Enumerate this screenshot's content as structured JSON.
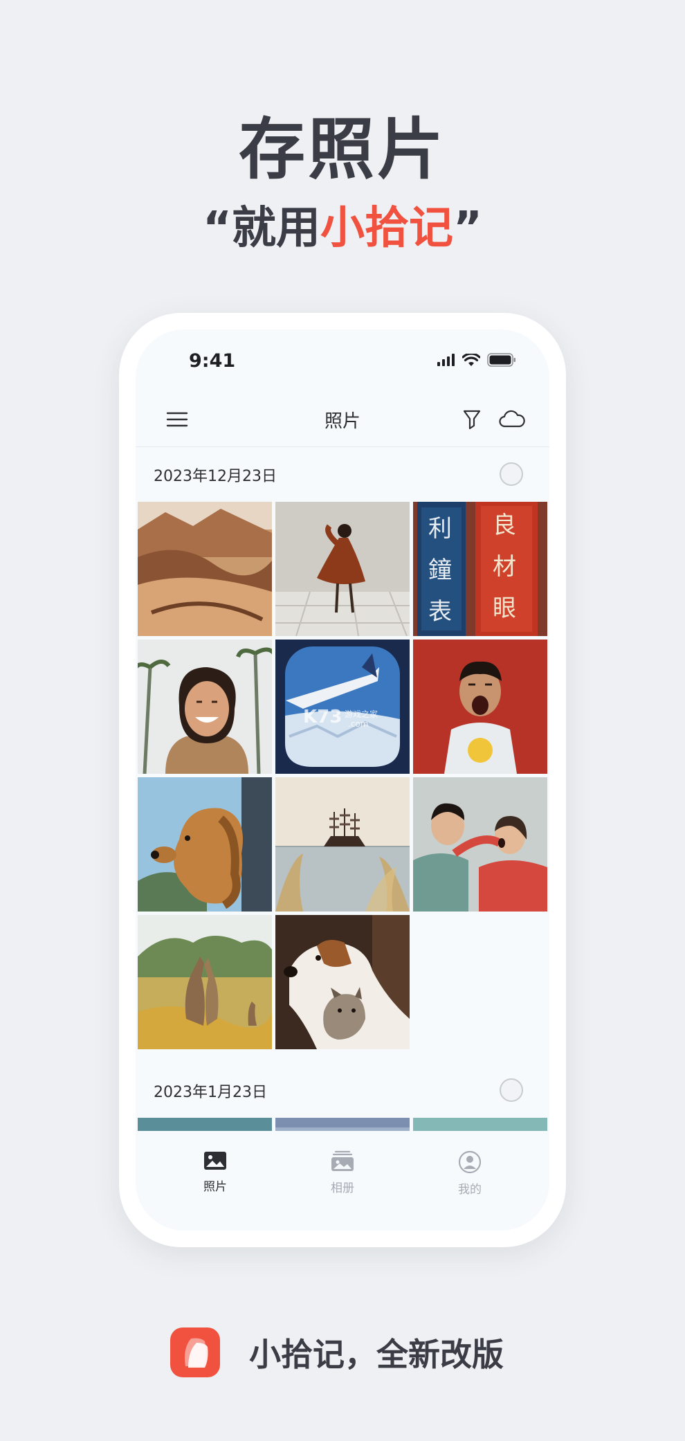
{
  "promo": {
    "headline": "存照片",
    "quote_open": "“",
    "sub_prefix": "就用",
    "sub_accent": "小拾记",
    "quote_close": "”",
    "footer": "小拾记，全新改版",
    "accent_color": "#f0523f"
  },
  "status_bar": {
    "time": "9:41"
  },
  "navbar": {
    "title": "照片",
    "left_icon": "menu-icon",
    "right_icons": [
      "filter-icon",
      "cloud-icon"
    ]
  },
  "sections": [
    {
      "date": "2023年12月23日",
      "photos": [
        "desert-dunes",
        "dancer-red-dress",
        "chinese-signboards",
        "smiling-woman-palms",
        "airplane-window-wing",
        "boy-yawning-red",
        "dog-car-window",
        "sailing-ship",
        "kids-playing",
        "kangaroos",
        "dog-and-cat"
      ]
    },
    {
      "date": "2023年1月23日",
      "photos": [
        "teal-photo",
        "sky-photo",
        "aqua-photo"
      ]
    }
  ],
  "watermark": {
    "brand": "K73",
    "cn": "游戏之家",
    "domain": ".com"
  },
  "tabbar": {
    "items": [
      {
        "label": "照片",
        "icon": "photo-icon",
        "active": true
      },
      {
        "label": "相册",
        "icon": "album-icon",
        "active": false
      },
      {
        "label": "我的",
        "icon": "profile-icon",
        "active": false
      }
    ]
  }
}
